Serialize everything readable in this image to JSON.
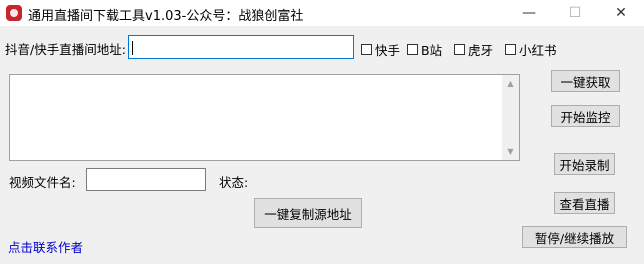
{
  "window": {
    "title": "通用直播间下载工具v1.03-公众号：战狼创富社",
    "minimize_glyph": "—",
    "maximize_glyph": "☐",
    "close_glyph": "✕"
  },
  "url_row": {
    "label": "抖音/快手直播间地址:",
    "value": "",
    "platforms": [
      {
        "label": "快手",
        "checked": false
      },
      {
        "label": "B站",
        "checked": false
      },
      {
        "label": "虎牙",
        "checked": false
      },
      {
        "label": "小红书",
        "checked": false
      }
    ]
  },
  "buttons": {
    "fetch": "一键获取",
    "monitor": "开始监控",
    "record": "开始录制",
    "view_live": "查看直播",
    "pause_resume": "暂停/继续播放",
    "copy_source": "一键复制源地址"
  },
  "file_row": {
    "filename_label": "视频文件名:",
    "filename_value": "",
    "status_label": "状态:",
    "status_value": ""
  },
  "contact_link": "点击联系作者",
  "colors": {
    "app_icon": "#c8262b",
    "link": "#0000cc",
    "focus_border": "#0078d7"
  }
}
